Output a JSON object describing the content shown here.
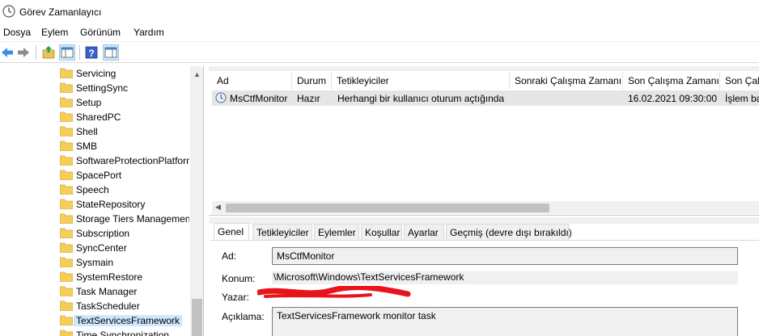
{
  "window": {
    "title": "Görev Zamanlayıcı"
  },
  "menu": [
    "Dosya",
    "Eylem",
    "Görünüm",
    "Yardım"
  ],
  "toolbar": {
    "icons": [
      "back-arrow-icon",
      "forward-arrow-icon",
      "up-folder-icon",
      "show-hide-tree-icon",
      "help-icon",
      "action-pane-icon"
    ]
  },
  "tree": {
    "items": [
      "Servicing",
      "SettingSync",
      "Setup",
      "SharedPC",
      "Shell",
      "SMB",
      "SoftwareProtectionPlatform",
      "SpacePort",
      "Speech",
      "StateRepository",
      "Storage Tiers Management",
      "Subscription",
      "SyncCenter",
      "Sysmain",
      "SystemRestore",
      "Task Manager",
      "TaskScheduler",
      "TextServicesFramework",
      "Time Synchronization"
    ],
    "selected": "TextServicesFramework"
  },
  "tasks": {
    "columns": [
      "Ad",
      "Durum",
      "Tetikleyiciler",
      "Sonraki Çalışma Zamanı",
      "Son Çalışma Zamanı",
      "Son Çalışma Sonucu"
    ],
    "rows": [
      {
        "name": "MsCtfMonitor",
        "status": "Hazır",
        "trigger": "Herhangi bir kullanıcı oturum açtığında",
        "next_run": "",
        "last_run": "16.02.2021 09:30:00",
        "last_result": "İşlem başarıyla tamamlandı."
      }
    ]
  },
  "details": {
    "tabs": [
      "Genel",
      "Tetikleyiciler",
      "Eylemler",
      "Koşullar",
      "Ayarlar",
      "Geçmiş (devre dışı bırakıldı)"
    ],
    "active_tab": "Genel",
    "name_label": "Ad:",
    "name_value": "MsCtfMonitor",
    "location_label": "Konum:",
    "location_value": "\\Microsoft\\Windows\\TextServicesFramework",
    "author_label": "Yazar:",
    "description_label": "Açıklama:",
    "description_value": "TextServicesFramework monitor task"
  },
  "colors": {
    "selection": "#cce8ff",
    "row_highlight": "#e5e5e5",
    "redaction": "#e8141b"
  }
}
